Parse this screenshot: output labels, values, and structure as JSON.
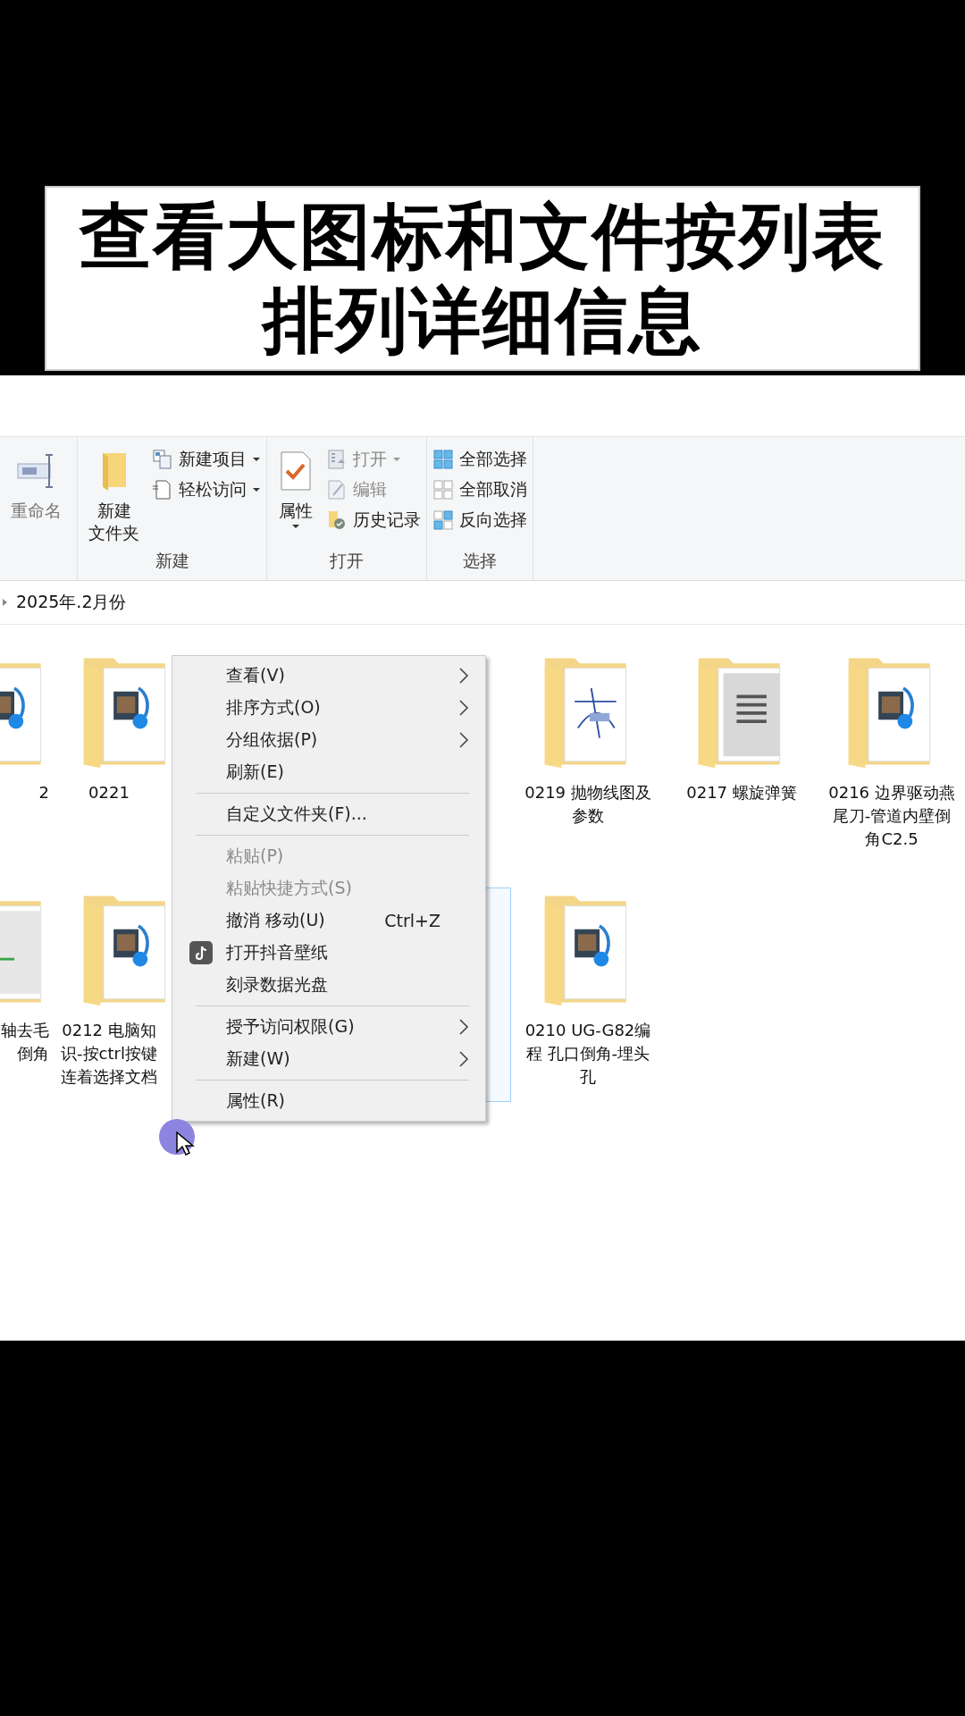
{
  "caption": {
    "lines": [
      "查看大图标和文件按列表",
      "排列详细信息"
    ]
  },
  "ribbon": {
    "groups": [
      {
        "large": [
          {
            "lines": [
              "重命名"
            ],
            "disabled": true,
            "dropdown": false
          }
        ]
      },
      {
        "label": "新建",
        "large": [
          {
            "lines": [
              "新建",
              "文件夹"
            ],
            "disabled": false,
            "dropdown": false
          }
        ],
        "small": [
          {
            "label": "新建项目",
            "dropdown": true,
            "disabled": false
          },
          {
            "label": "轻松访问",
            "dropdown": true,
            "disabled": false
          }
        ]
      },
      {
        "label": "打开",
        "large": [
          {
            "lines": [
              "属性"
            ],
            "disabled": false,
            "dropdown": true
          }
        ],
        "small": [
          {
            "label": "打开",
            "dropdown": true,
            "disabled": true
          },
          {
            "label": "编辑",
            "dropdown": false,
            "disabled": true
          },
          {
            "label": "历史记录",
            "dropdown": false,
            "disabled": false
          }
        ]
      },
      {
        "label": "选择",
        "small": [
          {
            "label": "全部选择",
            "dropdown": false,
            "disabled": false
          },
          {
            "label": "全部取消",
            "dropdown": false,
            "disabled": false
          },
          {
            "label": "反向选择",
            "dropdown": false,
            "disabled": false
          }
        ]
      }
    ]
  },
  "breadcrumb": {
    "path": "2025年.2月份"
  },
  "folders": [
    {
      "name": "2",
      "kind": "media",
      "selected": false
    },
    {
      "name": "0221",
      "kind": "media",
      "selected": false
    },
    {
      "kind": "covered"
    },
    {
      "kind": "covered",
      "selected": false
    },
    {
      "name": "0219 抛物线图及参数",
      "kind": "drawing",
      "selected": false
    },
    {
      "name": "0217 螺旋弹簧",
      "kind": "spring",
      "selected": false
    },
    {
      "name": "0216 边界驱动燕尾刀-管道内壁倒角C2.5",
      "kind": "media",
      "selected": false
    },
    {
      "name": "轴去毛倒角",
      "kind": "doc",
      "selected": false
    },
    {
      "name": "0212 电脑知识-按ctrl按键连着选择文档",
      "kind": "media",
      "selected": false
    },
    {
      "kind": "covered"
    },
    {
      "kind": "covered",
      "selected": true
    },
    {
      "name": "0210 UG-G82编程 孔口倒角-埋头孔",
      "kind": "media",
      "selected": false
    }
  ],
  "context_menu": {
    "items": [
      {
        "kind": "item",
        "label": "查看(V)",
        "disabled": false,
        "submenu": true
      },
      {
        "kind": "item",
        "label": "排序方式(O)",
        "disabled": false,
        "submenu": true
      },
      {
        "kind": "item",
        "label": "分组依据(P)",
        "disabled": false,
        "submenu": true
      },
      {
        "kind": "item",
        "label": "刷新(E)",
        "disabled": false,
        "submenu": false
      },
      {
        "kind": "separator"
      },
      {
        "kind": "item",
        "label": "自定义文件夹(F)...",
        "disabled": false,
        "submenu": false
      },
      {
        "kind": "separator"
      },
      {
        "kind": "item",
        "label": "粘贴(P)",
        "disabled": true,
        "submenu": false
      },
      {
        "kind": "item",
        "label": "粘贴快捷方式(S)",
        "disabled": true,
        "submenu": false
      },
      {
        "kind": "item",
        "label": "撤消 移动(U)",
        "disabled": false,
        "submenu": false,
        "shortcut": "Ctrl+Z"
      },
      {
        "kind": "app",
        "label": "打开抖音壁纸",
        "disabled": false,
        "submenu": false
      },
      {
        "kind": "item",
        "label": "刻录数据光盘",
        "disabled": false,
        "submenu": false
      },
      {
        "kind": "separator"
      },
      {
        "kind": "item",
        "label": "授予访问权限(G)",
        "disabled": false,
        "submenu": true
      },
      {
        "kind": "item",
        "label": "新建(W)",
        "disabled": false,
        "submenu": true
      },
      {
        "kind": "separator"
      },
      {
        "kind": "item",
        "label": "属性(R)",
        "disabled": false,
        "submenu": false
      }
    ]
  }
}
